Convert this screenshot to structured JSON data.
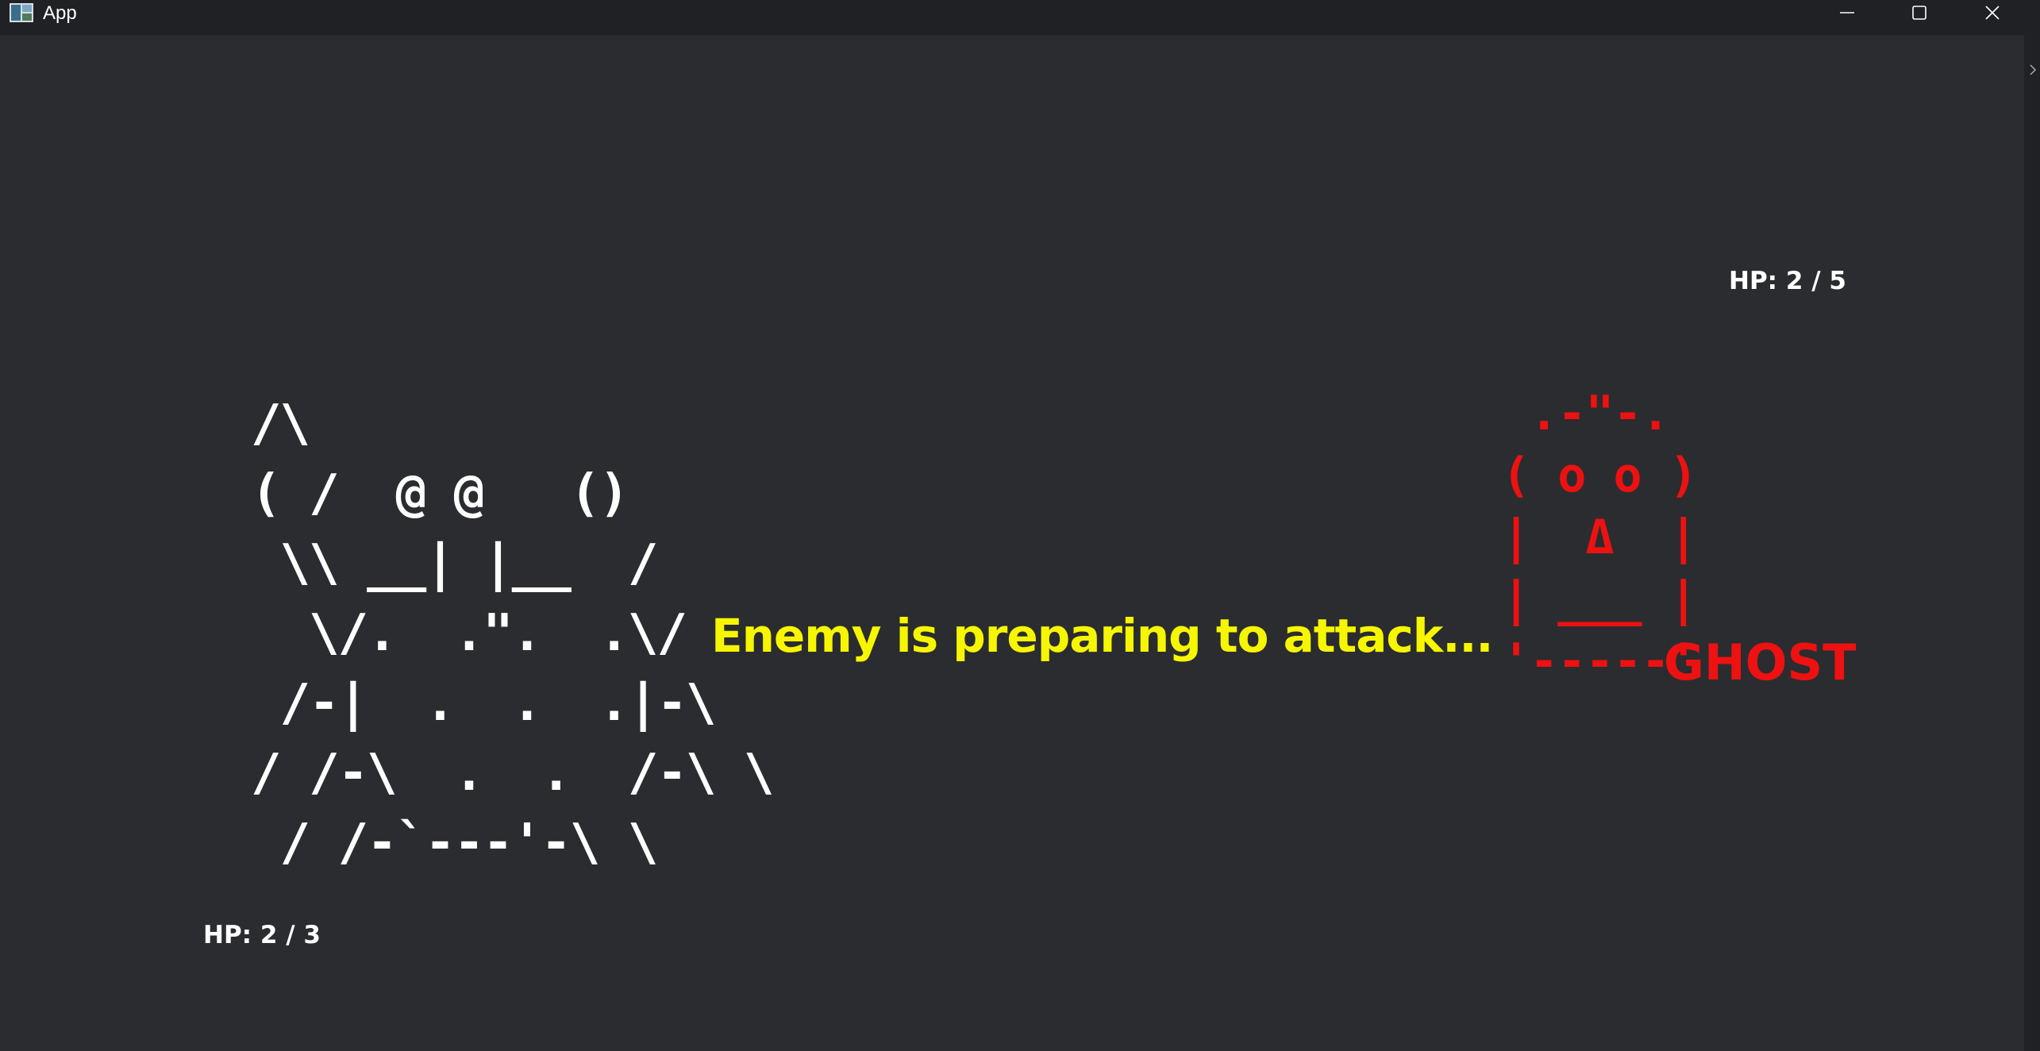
{
  "window": {
    "title": "App",
    "icons": {
      "app": "app-icon",
      "minimize": "minimize-icon",
      "maximize": "maximize-icon",
      "close": "close-icon"
    }
  },
  "game": {
    "enemy": {
      "hp_label": "HP: 2 / 5",
      "hp_current": 2,
      "hp_max": 5,
      "name": "GHOST",
      "art": " .-\"-.\n( o o )\n|  Δ  |\n| ___ |\n'-----'",
      "color": "#ee1111"
    },
    "player": {
      "hp_label": "HP: 2 / 3",
      "hp_current": 2,
      "hp_max": 3,
      "art": "/\\\n( /  @ @   ()\n \\\\ __| |__  /\n  \\/.  .\".  .\\/\n /-|  .  .  .|-\\\n/ /-\\  .  .  /-\\ \\\n / /-`---'-\\ \\",
      "color": "#ffffff"
    },
    "message": "Enemy is preparing to attack...",
    "message_color": "#f6f600"
  }
}
